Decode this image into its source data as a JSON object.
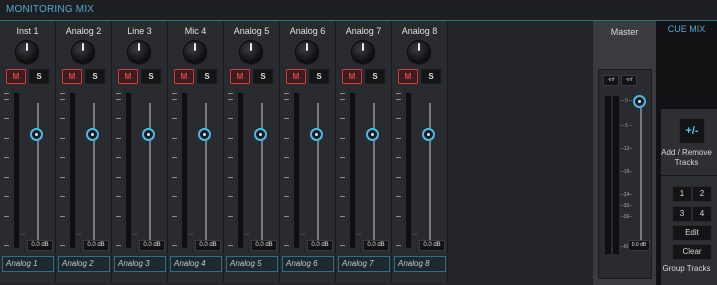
{
  "header": {
    "title": "MONITORING MIX"
  },
  "strips": [
    {
      "name": "Inst 1",
      "mute": "M",
      "solo": "S",
      "level_db": "0.0 dB",
      "source": "Analog 1"
    },
    {
      "name": "Analog 2",
      "mute": "M",
      "solo": "S",
      "level_db": "0.0 dB",
      "source": "Analog 2"
    },
    {
      "name": "Line 3",
      "mute": "M",
      "solo": "S",
      "level_db": "0.0 dB",
      "source": "Analog 3"
    },
    {
      "name": "Mic 4",
      "mute": "M",
      "solo": "S",
      "level_db": "0.0 dB",
      "source": "Analog 4"
    },
    {
      "name": "Analog 5",
      "mute": "M",
      "solo": "S",
      "level_db": "0.0 dB",
      "source": "Analog 5"
    },
    {
      "name": "Analog 6",
      "mute": "M",
      "solo": "S",
      "level_db": "0.0 dB",
      "source": "Analog 6"
    },
    {
      "name": "Analog 7",
      "mute": "M",
      "solo": "S",
      "level_db": "0.0 dB",
      "source": "Analog 7"
    },
    {
      "name": "Analog 8",
      "mute": "M",
      "solo": "S",
      "level_db": "0.0 dB",
      "source": "Analog 8"
    }
  ],
  "master": {
    "title": "Master",
    "peak_left": "-inf",
    "peak_right": "-inf",
    "level_db": "0.0 dB",
    "scale": [
      "0",
      "6",
      "12",
      "18",
      "24",
      "30",
      "36",
      "60"
    ]
  },
  "cue_mix": {
    "title": "CUE MIX",
    "add_remove_symbol": "+/-",
    "add_remove_label": "Add / Remove Tracks",
    "group_buttons": [
      "1",
      "2",
      "3",
      "4"
    ],
    "edit_label": "Edit",
    "clear_label": "Clear",
    "group_tracks_label": "Group Tracks"
  },
  "colors": {
    "accent": "#4fa9d1",
    "mute": "#d33a3a",
    "fader_handle": "#4db8e6"
  }
}
